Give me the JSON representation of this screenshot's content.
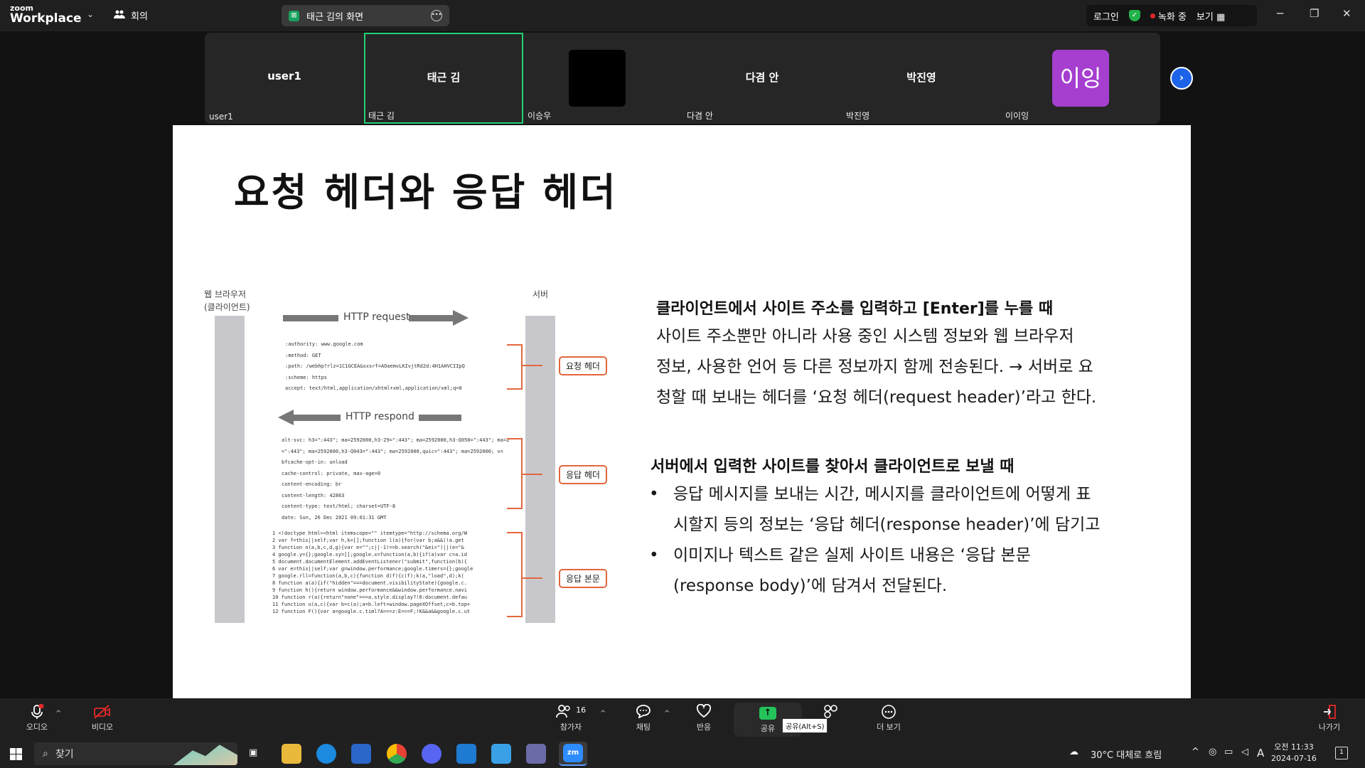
{
  "titlebar": {
    "logo_top": "zoom",
    "logo_bottom": "Workplace",
    "meetings_label": "회의",
    "share_title": "태근 김의 화면",
    "login_label": "로그인",
    "recording_label": "녹화 중",
    "view_label": "보기"
  },
  "participants": [
    {
      "center": "user1",
      "label": "user1",
      "active": false
    },
    {
      "center": "태근 김",
      "label": "태근 김",
      "active": true
    },
    {
      "center": "",
      "label": "이승우",
      "active": false
    },
    {
      "center": "다겸 안",
      "label": "다겸 안",
      "active": false
    },
    {
      "center": "박진영",
      "label": "박진영",
      "active": false
    },
    {
      "center": "이잉",
      "label": "이이잉",
      "active": false
    }
  ],
  "slide": {
    "title": "요청 헤더와 응답 헤더",
    "figure": {
      "client_label_1": "웹 브라우저",
      "client_label_2": "(클라이언트)",
      "server_label": "서버",
      "request_label": "HTTP request",
      "respond_label": "HTTP respond",
      "request_header_tag": "요청 헤더",
      "response_header_tag": "응답 헤더",
      "response_body_tag": "응답 본문",
      "request_lines": [
        ":authority: www.google.com",
        ":method: GET",
        ":path: /webhp?rlz=1C1GCEA&sxsrf=AOaemvLKIvjtRd2d:4H1AHVCIIpQ",
        ":scheme: https",
        "accept: text/html,application/xhtml+xml,application/xml;q=0"
      ],
      "response_lines": [
        "alt-svc: h3=\":443\"; ma=2592000,h3-29=\":443\"; ma=2592000,h3-Q050=\":443\"; ma=2",
        "=\":443\"; ma=2592000,h3-Q043=\":443\"; ma=2592000,quic=\":443\"; ma=2592000; v=",
        "bfcache-opt-in: unload",
        "cache-control: private, max-age=0",
        "content-encoding: br",
        "content-length: 42863",
        "content-type: text/html; charset=UTF-8",
        "date: Sun, 26 Dec 2021 09:01:31 GMT"
      ],
      "code_lines": [
        " 1  <!doctype html><html itemscope=\"\" itemtype=\"http://schema.org/W",
        " 2  var f=this||self;var h,k=[];function l(a){for(var b;a&&(!a.get",
        " 3  function n(a,b,c,d,g){var e=\"\";c||-1!==b.search(\"&ei=\")||(e=\"&",
        " 4  google.y={};google.sy=[];google.x=function(a,b){if(a)var c=a.id",
        " 5  document.documentElement.addEventListener(\"submit\",function(b){",
        " 6  var e=this||self;var g=window.performance;google.timers={};google",
        " 7  google.rll=function(a,b,c){function d(f){c(f);k(a,\"load\",d);k(",
        " 8  function a(a){if(\"hidden\"===document.visibilityState){google.c.",
        " 9  function h(){return window.performance&&window.performance.navi",
        "10  function r(a){return\"none\"===a.style.display?!0:document.defau",
        "11  function u(a,c){var b=c(a);a=b.left+window.pageXOffset;c=b.top+",
        "12  function F(){var a=google.c.timl?A===z:E===F;!K&&a&&google.c.ut"
      ]
    },
    "section1_head": "클라이언트에서 사이트 주소를 입력하고 [Enter]를 누를 때",
    "section1_lines": [
      "사이트 주소뿐만 아니라 사용 중인 시스템 정보와 웹 브라우저",
      "정보, 사용한 언어 등 다른 정보까지 함께 전송된다. → 서버로 요",
      "청할 때 보내는 헤더를 ‘요청 헤더(request header)’라고 한다."
    ],
    "section2_head": "서버에서 입력한 사이트를 찾아서 클라이언트로 보낼 때",
    "bullet1_lines": [
      "응답 메시지를 보내는 시간, 메시지를 클라이언트에 어떻게 표",
      "시할지 등의 정보는 ‘응답 헤더(response header)’에 담기고"
    ],
    "bullet2_lines": [
      "이미지나 텍스트 같은 실제 사이트 내용은 ‘응답 본문",
      "(response body)’에 담겨서 전달된다."
    ]
  },
  "toolbar": {
    "audio": "오디오",
    "video": "비디오",
    "participants": "참가자",
    "participant_count": "16",
    "chat": "채팅",
    "reactions": "반응",
    "share": "공유",
    "share_tooltip": "공유(Alt+S)",
    "more": "더 보기",
    "leave": "나가기"
  },
  "taskbar": {
    "search": "찾기",
    "weather": "30°C 대체로 흐림",
    "ime": "A",
    "time": "오전 11:33",
    "date": "2024-07-16",
    "notifications": "1"
  },
  "colors": {
    "active_border": "#23d175",
    "accent_orange": "#e2673e",
    "avatar_purple": "#a63fd0",
    "share_green": "#23c35a",
    "next_blue": "#1c63e8"
  }
}
